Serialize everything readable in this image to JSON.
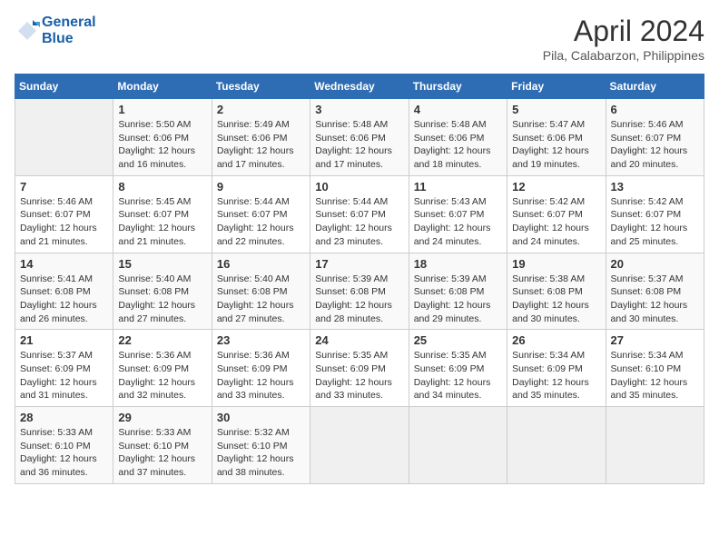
{
  "header": {
    "logo_line1": "General",
    "logo_line2": "Blue",
    "month": "April 2024",
    "location": "Pila, Calabarzon, Philippines"
  },
  "weekdays": [
    "Sunday",
    "Monday",
    "Tuesday",
    "Wednesday",
    "Thursday",
    "Friday",
    "Saturday"
  ],
  "weeks": [
    [
      {
        "day": "",
        "info": ""
      },
      {
        "day": "1",
        "info": "Sunrise: 5:50 AM\nSunset: 6:06 PM\nDaylight: 12 hours\nand 16 minutes."
      },
      {
        "day": "2",
        "info": "Sunrise: 5:49 AM\nSunset: 6:06 PM\nDaylight: 12 hours\nand 17 minutes."
      },
      {
        "day": "3",
        "info": "Sunrise: 5:48 AM\nSunset: 6:06 PM\nDaylight: 12 hours\nand 17 minutes."
      },
      {
        "day": "4",
        "info": "Sunrise: 5:48 AM\nSunset: 6:06 PM\nDaylight: 12 hours\nand 18 minutes."
      },
      {
        "day": "5",
        "info": "Sunrise: 5:47 AM\nSunset: 6:06 PM\nDaylight: 12 hours\nand 19 minutes."
      },
      {
        "day": "6",
        "info": "Sunrise: 5:46 AM\nSunset: 6:07 PM\nDaylight: 12 hours\nand 20 minutes."
      }
    ],
    [
      {
        "day": "7",
        "info": "Sunrise: 5:46 AM\nSunset: 6:07 PM\nDaylight: 12 hours\nand 21 minutes."
      },
      {
        "day": "8",
        "info": "Sunrise: 5:45 AM\nSunset: 6:07 PM\nDaylight: 12 hours\nand 21 minutes."
      },
      {
        "day": "9",
        "info": "Sunrise: 5:44 AM\nSunset: 6:07 PM\nDaylight: 12 hours\nand 22 minutes."
      },
      {
        "day": "10",
        "info": "Sunrise: 5:44 AM\nSunset: 6:07 PM\nDaylight: 12 hours\nand 23 minutes."
      },
      {
        "day": "11",
        "info": "Sunrise: 5:43 AM\nSunset: 6:07 PM\nDaylight: 12 hours\nand 24 minutes."
      },
      {
        "day": "12",
        "info": "Sunrise: 5:42 AM\nSunset: 6:07 PM\nDaylight: 12 hours\nand 24 minutes."
      },
      {
        "day": "13",
        "info": "Sunrise: 5:42 AM\nSunset: 6:07 PM\nDaylight: 12 hours\nand 25 minutes."
      }
    ],
    [
      {
        "day": "14",
        "info": "Sunrise: 5:41 AM\nSunset: 6:08 PM\nDaylight: 12 hours\nand 26 minutes."
      },
      {
        "day": "15",
        "info": "Sunrise: 5:40 AM\nSunset: 6:08 PM\nDaylight: 12 hours\nand 27 minutes."
      },
      {
        "day": "16",
        "info": "Sunrise: 5:40 AM\nSunset: 6:08 PM\nDaylight: 12 hours\nand 27 minutes."
      },
      {
        "day": "17",
        "info": "Sunrise: 5:39 AM\nSunset: 6:08 PM\nDaylight: 12 hours\nand 28 minutes."
      },
      {
        "day": "18",
        "info": "Sunrise: 5:39 AM\nSunset: 6:08 PM\nDaylight: 12 hours\nand 29 minutes."
      },
      {
        "day": "19",
        "info": "Sunrise: 5:38 AM\nSunset: 6:08 PM\nDaylight: 12 hours\nand 30 minutes."
      },
      {
        "day": "20",
        "info": "Sunrise: 5:37 AM\nSunset: 6:08 PM\nDaylight: 12 hours\nand 30 minutes."
      }
    ],
    [
      {
        "day": "21",
        "info": "Sunrise: 5:37 AM\nSunset: 6:09 PM\nDaylight: 12 hours\nand 31 minutes."
      },
      {
        "day": "22",
        "info": "Sunrise: 5:36 AM\nSunset: 6:09 PM\nDaylight: 12 hours\nand 32 minutes."
      },
      {
        "day": "23",
        "info": "Sunrise: 5:36 AM\nSunset: 6:09 PM\nDaylight: 12 hours\nand 33 minutes."
      },
      {
        "day": "24",
        "info": "Sunrise: 5:35 AM\nSunset: 6:09 PM\nDaylight: 12 hours\nand 33 minutes."
      },
      {
        "day": "25",
        "info": "Sunrise: 5:35 AM\nSunset: 6:09 PM\nDaylight: 12 hours\nand 34 minutes."
      },
      {
        "day": "26",
        "info": "Sunrise: 5:34 AM\nSunset: 6:09 PM\nDaylight: 12 hours\nand 35 minutes."
      },
      {
        "day": "27",
        "info": "Sunrise: 5:34 AM\nSunset: 6:10 PM\nDaylight: 12 hours\nand 35 minutes."
      }
    ],
    [
      {
        "day": "28",
        "info": "Sunrise: 5:33 AM\nSunset: 6:10 PM\nDaylight: 12 hours\nand 36 minutes."
      },
      {
        "day": "29",
        "info": "Sunrise: 5:33 AM\nSunset: 6:10 PM\nDaylight: 12 hours\nand 37 minutes."
      },
      {
        "day": "30",
        "info": "Sunrise: 5:32 AM\nSunset: 6:10 PM\nDaylight: 12 hours\nand 38 minutes."
      },
      {
        "day": "",
        "info": ""
      },
      {
        "day": "",
        "info": ""
      },
      {
        "day": "",
        "info": ""
      },
      {
        "day": "",
        "info": ""
      }
    ]
  ]
}
